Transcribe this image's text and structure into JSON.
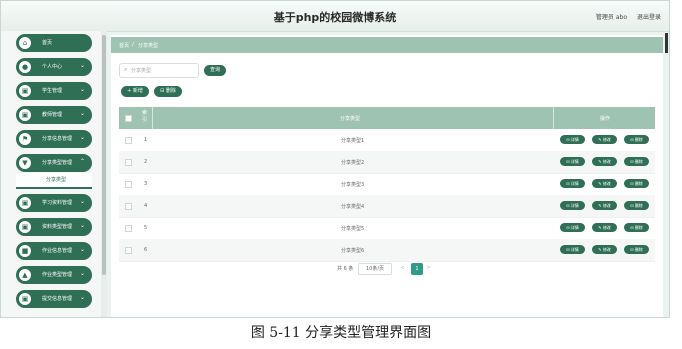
{
  "header": {
    "title": "基于php的校园微博系统",
    "user": "管理员 abo",
    "logout": "退出登录"
  },
  "sidebar": {
    "items": [
      {
        "label": "首页",
        "icon": "home-icon",
        "glyph": "⌂"
      },
      {
        "label": "个人中心",
        "icon": "user-icon",
        "glyph": "●"
      },
      {
        "label": "学生管理",
        "icon": "student-icon",
        "glyph": "▣"
      },
      {
        "label": "教师管理",
        "icon": "teacher-icon",
        "glyph": "▣"
      },
      {
        "label": "分享信息管理",
        "icon": "flag-icon",
        "glyph": "⚑"
      },
      {
        "label": "分享类型管理",
        "icon": "funnel-icon",
        "glyph": "▼"
      },
      {
        "label": "学习资料管理",
        "icon": "grid-icon",
        "glyph": "▣"
      },
      {
        "label": "资料类型管理",
        "icon": "grid-icon",
        "glyph": "▣"
      },
      {
        "label": "作业信息管理",
        "icon": "trash-icon",
        "glyph": "■"
      },
      {
        "label": "作业类型管理",
        "icon": "chart-icon",
        "glyph": "▲"
      },
      {
        "label": "提交信息管理",
        "icon": "grid-icon",
        "glyph": "▣"
      }
    ],
    "active_sub": "分享类型"
  },
  "breadcrumb": {
    "home": "首页",
    "sep": "/",
    "current": "分享类型"
  },
  "search": {
    "placeholder": "分享类型",
    "button": "查询"
  },
  "toolbar": {
    "add": "+ 新增",
    "delete": "删除"
  },
  "table": {
    "headers": {
      "index": "索引",
      "type": "分享类型",
      "actions": "操作"
    },
    "rows": [
      {
        "index": "1",
        "type": "分享类型1"
      },
      {
        "index": "2",
        "type": "分享类型2"
      },
      {
        "index": "3",
        "type": "分享类型3"
      },
      {
        "index": "4",
        "type": "分享类型4"
      },
      {
        "index": "5",
        "type": "分享类型5"
      },
      {
        "index": "6",
        "type": "分享类型6"
      }
    ],
    "actions": {
      "detail": "详情",
      "edit": "修改",
      "delete": "删除"
    }
  },
  "pagination": {
    "total": "共 6 条",
    "page_size": "10条/页",
    "prev": "<",
    "current": "1",
    "next": ">"
  },
  "caption": "图 5-11 分享类型管理界面图",
  "colors": {
    "primary": "#2f6f56",
    "header_row": "#9fc3b3",
    "background": "#eaf3ef"
  }
}
